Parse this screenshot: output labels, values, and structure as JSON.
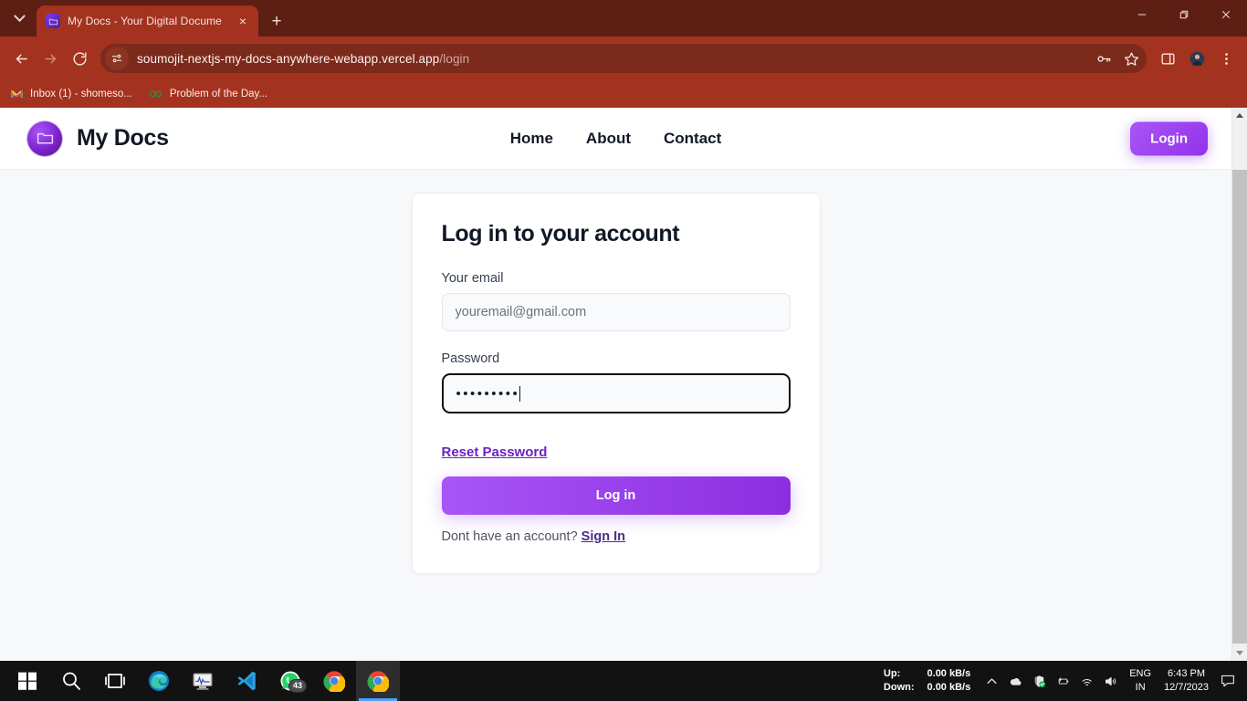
{
  "browser": {
    "tab": {
      "title": "My Docs - Your Digital Docume",
      "favicon": "folder-icon",
      "close": "×"
    },
    "new_tab_label": "+",
    "toolbar": {
      "back_icon": "back-arrow-icon",
      "forward_icon": "forward-arrow-icon",
      "reload_icon": "reload-icon",
      "site_settings_icon": "site-settings-icon",
      "url": "soumojit-nextjs-my-docs-anywhere-webapp.vercel.app",
      "url_path": "/login",
      "password_key_icon": "key-icon",
      "bookmark_icon": "star-icon",
      "side_panel_icon": "side-panel-icon",
      "profile_icon": "profile-avatar",
      "menu_icon": "three-dot-menu-icon"
    },
    "bookmarks": [
      {
        "label": "Inbox (1) - shomeso...",
        "icon": "gmail-icon"
      },
      {
        "label": "Problem of the Day...",
        "icon": "geeksforgeeks-icon"
      }
    ],
    "window_controls": {
      "minimize": "minimize-icon",
      "maximize": "restore-icon",
      "close": "close-icon"
    }
  },
  "site": {
    "brand": {
      "name": "My Docs",
      "logo_icon": "folder-logo-icon"
    },
    "nav": [
      {
        "label": "Home"
      },
      {
        "label": "About"
      },
      {
        "label": "Contact"
      }
    ],
    "login_button": "Login"
  },
  "login_card": {
    "title": "Log in to your account",
    "email": {
      "label": "Your email",
      "placeholder": "youremail@gmail.com",
      "value": ""
    },
    "password": {
      "label": "Password",
      "masked_value": "•••••••••",
      "char_count": 9,
      "focused": true
    },
    "reset_link": "Reset Password",
    "submit_button": "Log in",
    "signup_prompt": "Dont have an account?",
    "signup_link": "Sign In"
  },
  "colors": {
    "browser_chrome": "#a3321f",
    "tab_strip": "#5d1e14",
    "omnibox": "#7c2a1b",
    "page_background": "#f7f8fa",
    "card_background": "#ffffff",
    "accent_purple": "#9333ea",
    "accent_purple_light": "#a855f7",
    "link_purple": "#6b21c8",
    "heading": "#111827"
  },
  "taskbar": {
    "apps": [
      {
        "name": "start-button",
        "icon": "windows-logo-icon"
      },
      {
        "name": "search-button",
        "icon": "search-icon"
      },
      {
        "name": "task-view-button",
        "icon": "task-view-icon"
      },
      {
        "name": "edge-app",
        "icon": "edge-icon"
      },
      {
        "name": "system-monitor-app",
        "icon": "monitor-icon"
      },
      {
        "name": "vscode-app",
        "icon": "vscode-icon"
      },
      {
        "name": "whatsapp-app",
        "icon": "whatsapp-icon",
        "badge": "43"
      },
      {
        "name": "chrome-app",
        "icon": "chrome-icon"
      },
      {
        "name": "chrome-app-active",
        "icon": "chrome-icon",
        "active": true
      }
    ],
    "network": {
      "up_label": "Up:",
      "down_label": "Down:",
      "up_value": "0.00 kB/s",
      "down_value": "0.00 kB/s"
    },
    "tray_icons": [
      "show-hidden-icons-chevron",
      "onedrive-icon",
      "security-shield-icon",
      "battery-icon",
      "wifi-icon",
      "volume-icon"
    ],
    "language": {
      "line1": "ENG",
      "line2": "IN"
    },
    "clock": {
      "time": "6:43 PM",
      "date": "12/7/2023"
    },
    "notification_icon": "notification-center-icon"
  }
}
